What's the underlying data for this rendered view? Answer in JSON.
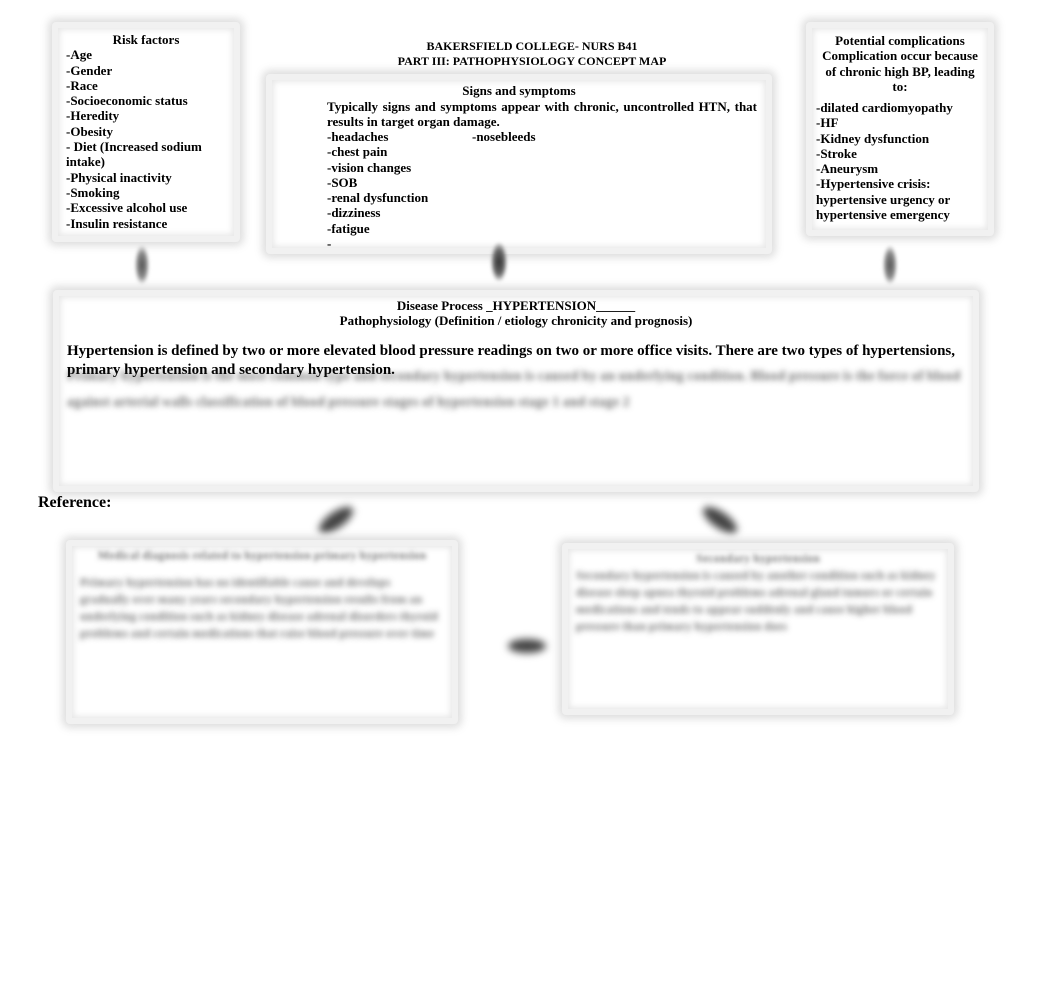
{
  "document": {
    "title_line1": "BAKERSFIELD COLLEGE-  NURS B41",
    "title_line2": "PART III:  PATHOPHYSIOLOGY CONCEPT MAP"
  },
  "risk_factors": {
    "heading": "Risk factors",
    "items": [
      "-Age",
      "-Gender",
      "-Race",
      "-Socioeconomic status",
      "-Heredity",
      "-Obesity",
      "- Diet (Increased sodium",
      "intake)",
      "-Physical inactivity",
      "-Smoking",
      "-Excessive alcohol use",
      "-Insulin resistance"
    ]
  },
  "signs_symptoms": {
    "heading": "Signs and symptoms",
    "intro": "Typically signs and symptoms appear with chronic, uncontrolled HTN, that results in target organ damage.",
    "items": [
      "-headaches",
      "-chest pain",
      "-vision changes",
      "-SOB",
      "-renal dysfunction",
      "-dizziness",
      "-fatigue",
      "-"
    ],
    "secondary_item": "-nosebleeds"
  },
  "complications": {
    "heading_lines": [
      "Potential complications",
      "Complication occur because",
      "of chronic high BP, leading",
      "to:"
    ],
    "items": [
      "-dilated cardiomyopathy",
      "-HF",
      "-Kidney dysfunction",
      "-Stroke",
      "-Aneurysm",
      "-Hypertensive crisis:",
      "hypertensive urgency or",
      "hypertensive emergency"
    ]
  },
  "disease_process": {
    "heading": "Disease Process _HYPERTENSION______",
    "subheading": "Pathophysiology (Definition / etiology chronicity and prognosis)",
    "definition": "Hypertension is defined by two or more elevated blood pressure readings on two or more office visits. There are two types of hypertensions, primary hypertension and secondary hypertension.",
    "blurred_placeholder": "Primary hypertension is the most common type and secondary hypertension is caused by an underlying condition. Blood pressure is the force of blood against arterial walls classification of blood pressure stages of hypertension stage 1 and stage 2"
  },
  "reference": {
    "label": "Reference:"
  },
  "reference_boxes": {
    "left_blurred_title": "Medical diagnosis related to hypertension primary hypertension",
    "left_blurred_body": "Primary hypertension has no identifiable cause and develops gradually over many years secondary hypertension results from an underlying condition such as kidney disease adrenal disorders thyroid problems and certain medications that raise blood pressure over time",
    "right_blurred_title": "Secondary hypertension",
    "right_blurred_body": "Secondary hypertension is caused by another condition such as kidney disease sleep apnea thyroid problems adrenal gland tumors or certain medications and tends to appear suddenly and cause higher blood pressure than primary hypertension does"
  }
}
